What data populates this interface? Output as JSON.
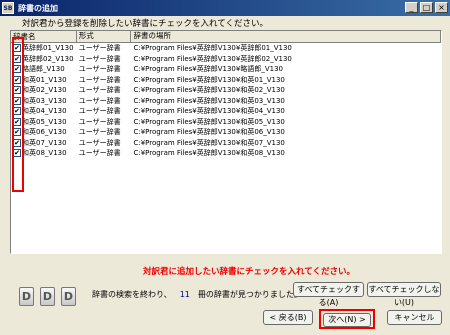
{
  "window": {
    "app_icon": "SB",
    "title": "辞書の追加",
    "minimize_label": "_",
    "maximize_label": "□",
    "close_label": "×"
  },
  "instruction": "対訳君から登録を削除したい辞書にチェックを入れてください。",
  "table": {
    "headers": [
      "辞書名",
      "形式",
      "辞書の場所"
    ],
    "rows": [
      {
        "name": "英辞郎01_V130",
        "type": "ユーザー辞書",
        "path": "C:¥Program Files¥英辞郎V130¥英辞郎01_V130",
        "checked": true
      },
      {
        "name": "英辞郎02_V130",
        "type": "ユーザー辞書",
        "path": "C:¥Program Files¥英辞郎V130¥英辞郎02_V130",
        "checked": true
      },
      {
        "name": "略語郎_V130",
        "type": "ユーザー辞書",
        "path": "C:¥Program Files¥英辞郎V130¥略語郎_V130",
        "checked": true
      },
      {
        "name": "和英01_V130",
        "type": "ユーザー辞書",
        "path": "C:¥Program Files¥英辞郎V130¥和英01_V130",
        "checked": true
      },
      {
        "name": "和英02_V130",
        "type": "ユーザー辞書",
        "path": "C:¥Program Files¥英辞郎V130¥和英02_V130",
        "checked": true
      },
      {
        "name": "和英03_V130",
        "type": "ユーザー辞書",
        "path": "C:¥Program Files¥英辞郎V130¥和英03_V130",
        "checked": true
      },
      {
        "name": "和英04_V130",
        "type": "ユーザー辞書",
        "path": "C:¥Program Files¥英辞郎V130¥和英04_V130",
        "checked": true
      },
      {
        "name": "和英05_V130",
        "type": "ユーザー辞書",
        "path": "C:¥Program Files¥英辞郎V130¥和英05_V130",
        "checked": true
      },
      {
        "name": "和英06_V130",
        "type": "ユーザー辞書",
        "path": "C:¥Program Files¥英辞郎V130¥和英06_V130",
        "checked": true
      },
      {
        "name": "和英07_V130",
        "type": "ユーザー辞書",
        "path": "C:¥Program Files¥英辞郎V130¥和英07_V130",
        "checked": true
      },
      {
        "name": "和英08_V130",
        "type": "ユーザー辞書",
        "path": "C:¥Program Files¥英辞郎V130¥和英08_V130",
        "checked": true
      }
    ]
  },
  "notice": "対訳君に追加したい辞書にチェックを入れてください。",
  "icons": [
    "dictionary-icon",
    "dictionary-icon",
    "dictionary-icon"
  ],
  "icon_letter": "D",
  "status": {
    "prefix": "辞書の検索を終わり、",
    "count": "11",
    "suffix": "冊の辞書が見つかりました。"
  },
  "buttons": {
    "check_all": "すべてチェックする(A)",
    "uncheck_all": "すべてチェックしない(U)",
    "back": "< 戻る(B)",
    "next": "次へ(N) >",
    "cancel": "キャンセル"
  },
  "colors": {
    "highlight": "#e00000",
    "titlebar": "#0a246a",
    "count": "#00008b"
  }
}
